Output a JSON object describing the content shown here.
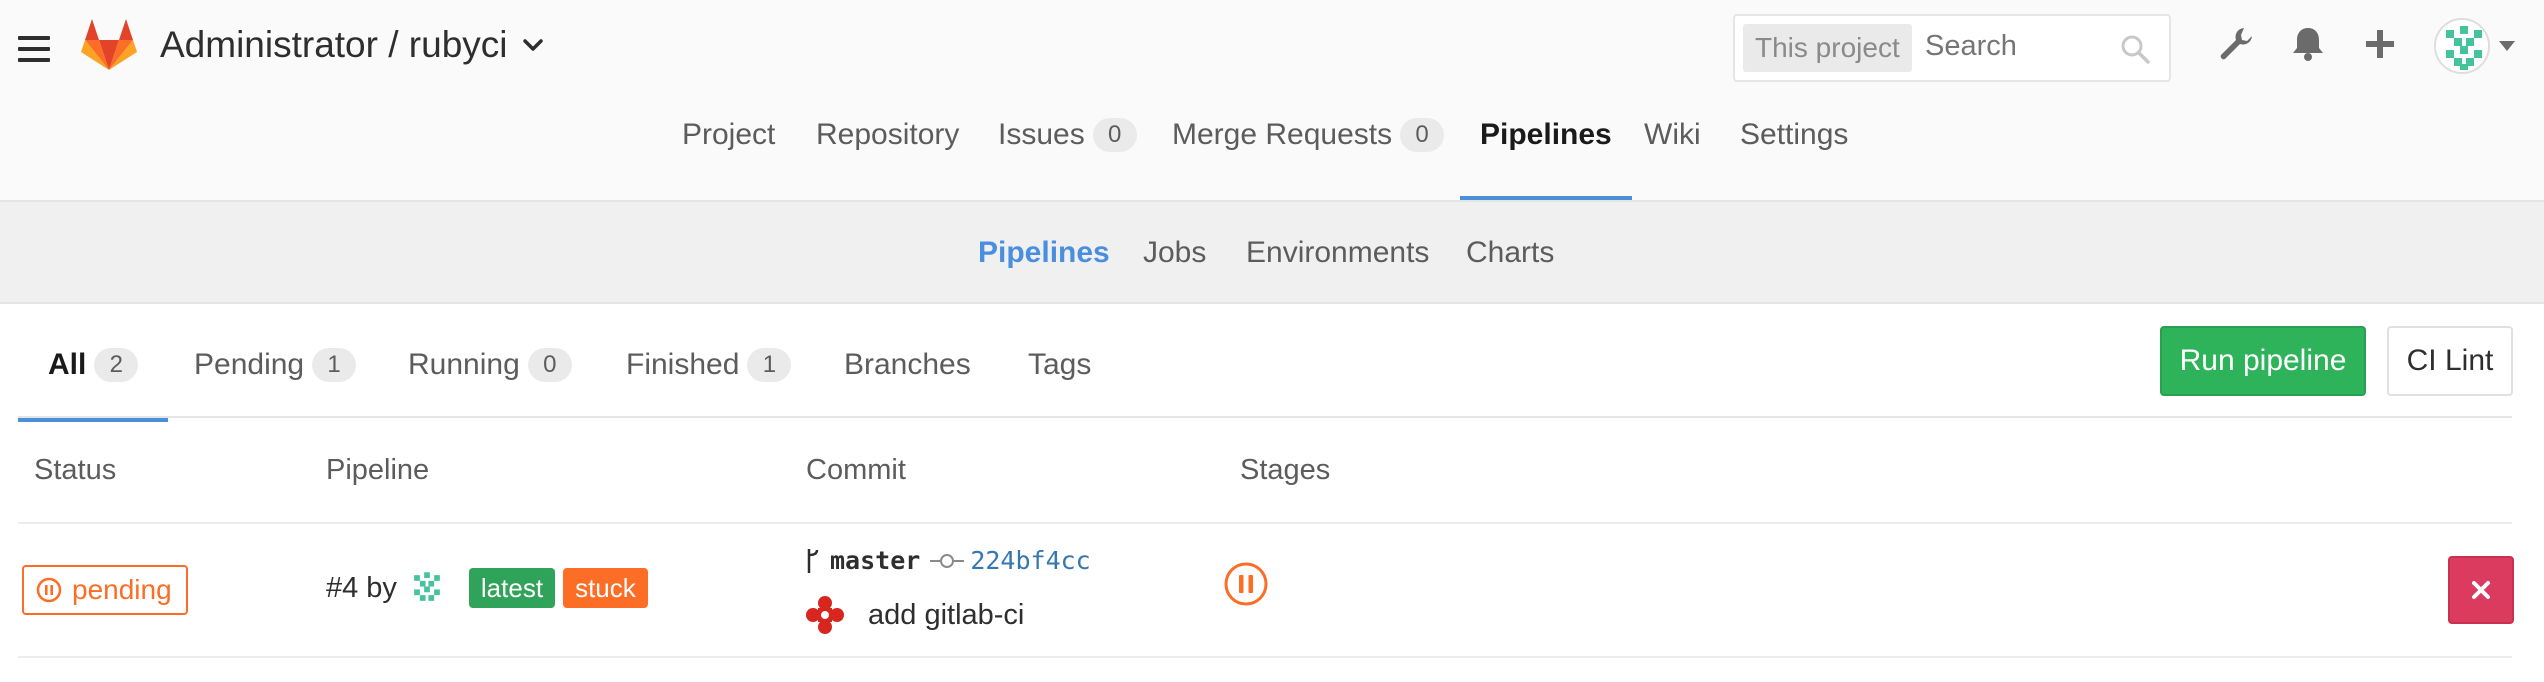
{
  "header": {
    "title": "Administrator / rubyci",
    "search_scope": "This project",
    "search_placeholder": "Search",
    "icons": [
      "hamburger-icon",
      "gitlab-logo",
      "chevron-down-icon",
      "search-icon",
      "wrench-icon",
      "bell-icon",
      "plus-icon",
      "avatar",
      "caret-down-icon"
    ]
  },
  "nav": {
    "items": [
      {
        "label": "Project"
      },
      {
        "label": "Repository"
      },
      {
        "label": "Issues",
        "count": "0"
      },
      {
        "label": "Merge Requests",
        "count": "0"
      },
      {
        "label": "Pipelines"
      },
      {
        "label": "Wiki"
      },
      {
        "label": "Settings"
      }
    ],
    "active": "Pipelines"
  },
  "subnav": {
    "items": [
      {
        "label": "Pipelines"
      },
      {
        "label": "Jobs"
      },
      {
        "label": "Environments"
      },
      {
        "label": "Charts"
      }
    ],
    "active": "Pipelines"
  },
  "tabs": {
    "items": [
      {
        "label": "All",
        "count": "2"
      },
      {
        "label": "Pending",
        "count": "1"
      },
      {
        "label": "Running",
        "count": "0"
      },
      {
        "label": "Finished",
        "count": "1"
      },
      {
        "label": "Branches"
      },
      {
        "label": "Tags"
      }
    ],
    "active": "All"
  },
  "actions": {
    "run_pipeline": "Run pipeline",
    "ci_lint": "CI Lint"
  },
  "table": {
    "headers": [
      "Status",
      "Pipeline",
      "Commit",
      "Stages"
    ],
    "rows": [
      {
        "status": "pending",
        "pipeline_id": "#4",
        "by": "by",
        "labels": [
          "latest",
          "stuck"
        ],
        "branch": "master",
        "sha": "224bf4cc",
        "message": "add gitlab-ci"
      }
    ]
  },
  "colors": {
    "accent_blue": "#4a90d9",
    "success_green": "#2fb35a",
    "pending_orange": "#fc6d26",
    "danger_red": "#db3b5f",
    "gitlab_orange": "#e24329"
  }
}
